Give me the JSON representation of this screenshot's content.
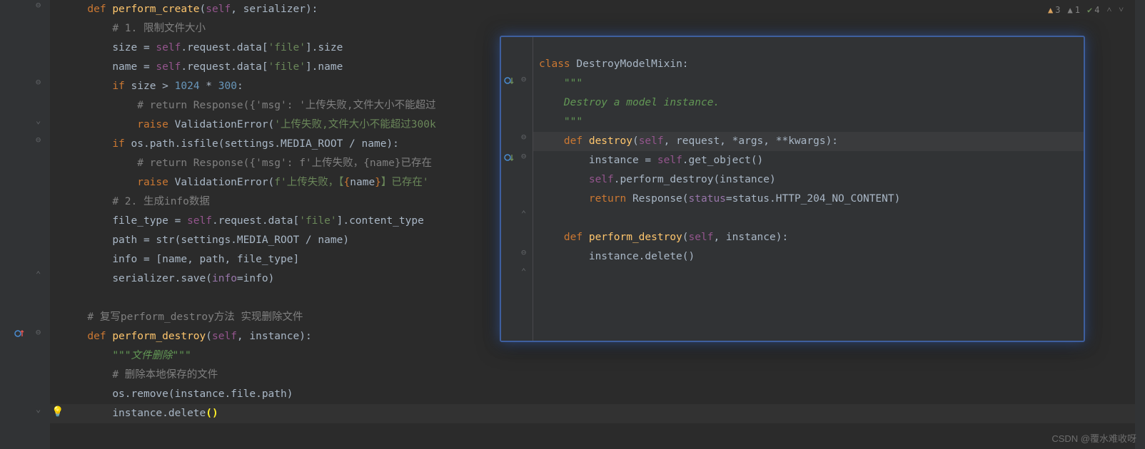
{
  "warnings": {
    "yellow_count": "3",
    "gray_count": "1",
    "green_count": "4"
  },
  "main": {
    "lines": [
      {
        "indent": "    ",
        "tokens": [
          [
            "c-kw",
            "def "
          ],
          [
            "c-funcdef",
            "perform_create"
          ],
          [
            "",
            "("
          ],
          [
            "c-self",
            "self"
          ],
          [
            "",
            ", serializer):"
          ]
        ]
      },
      {
        "indent": "        ",
        "tokens": [
          [
            "c-comment",
            "# 1. 限制文件大小"
          ]
        ]
      },
      {
        "indent": "        ",
        "tokens": [
          [
            "",
            "size = "
          ],
          [
            "c-self",
            "self"
          ],
          [
            "",
            ".request.data["
          ],
          [
            "c-str",
            "'file'"
          ],
          [
            "",
            "].size"
          ]
        ]
      },
      {
        "indent": "        ",
        "tokens": [
          [
            "",
            "name = "
          ],
          [
            "c-self",
            "self"
          ],
          [
            "",
            ".request.data["
          ],
          [
            "c-str",
            "'file'"
          ],
          [
            "",
            "].name"
          ]
        ]
      },
      {
        "indent": "        ",
        "tokens": [
          [
            "c-kw",
            "if "
          ],
          [
            "",
            "size > "
          ],
          [
            "c-num",
            "1024"
          ],
          [
            "",
            " * "
          ],
          [
            "c-num",
            "300"
          ],
          [
            "",
            ":"
          ]
        ]
      },
      {
        "indent": "            ",
        "tokens": [
          [
            "c-comment",
            "# return Response({'msg': '上传失败,文件大小不能超过"
          ]
        ]
      },
      {
        "indent": "            ",
        "tokens": [
          [
            "c-kw",
            "raise "
          ],
          [
            "",
            "ValidationError("
          ],
          [
            "c-str",
            "'上传失败,文件大小不能超过300k"
          ]
        ]
      },
      {
        "indent": "        ",
        "tokens": [
          [
            "c-kw",
            "if "
          ],
          [
            "",
            "os.path.isfile(settings.MEDIA_ROOT / name):"
          ]
        ]
      },
      {
        "indent": "            ",
        "tokens": [
          [
            "c-comment",
            "# return Response({'msg': f'上传失败，{name}已存在"
          ]
        ]
      },
      {
        "indent": "            ",
        "tokens": [
          [
            "c-kw",
            "raise "
          ],
          [
            "",
            "ValidationError("
          ],
          [
            "c-str",
            "f'上传失败，【"
          ],
          [
            "c-kw",
            "{"
          ],
          [
            "",
            "name"
          ],
          [
            "c-kw",
            "}"
          ],
          [
            "c-str",
            "】已存在'"
          ]
        ]
      },
      {
        "indent": "        ",
        "tokens": [
          [
            "c-comment",
            "# 2. 生成info数据"
          ]
        ]
      },
      {
        "indent": "        ",
        "tokens": [
          [
            "",
            "file_type = "
          ],
          [
            "c-self",
            "self"
          ],
          [
            "",
            ".request.data["
          ],
          [
            "c-str",
            "'file'"
          ],
          [
            "",
            "].content_type"
          ]
        ]
      },
      {
        "indent": "        ",
        "tokens": [
          [
            "",
            "path = str(settings.MEDIA_ROOT / name)"
          ]
        ]
      },
      {
        "indent": "        ",
        "tokens": [
          [
            "",
            "info = [name, path, file_type]"
          ]
        ]
      },
      {
        "indent": "        ",
        "tokens": [
          [
            "",
            "serializer.save("
          ],
          [
            "c-field",
            "info"
          ],
          [
            "",
            "=info)"
          ]
        ]
      },
      {
        "indent": "",
        "tokens": [
          [
            "",
            ""
          ]
        ]
      },
      {
        "indent": "    ",
        "tokens": [
          [
            "c-comment",
            "# 复写perform_destroy方法 实现删除文件"
          ]
        ]
      },
      {
        "indent": "    ",
        "tokens": [
          [
            "c-kw",
            "def "
          ],
          [
            "c-funcdef",
            "perform_destroy"
          ],
          [
            "",
            "("
          ],
          [
            "c-self",
            "self"
          ],
          [
            "",
            ", instance):"
          ]
        ]
      },
      {
        "indent": "        ",
        "tokens": [
          [
            "c-docq",
            "\"\"\""
          ],
          [
            "c-doc",
            "文件删除"
          ],
          [
            "c-docq",
            "\"\"\""
          ]
        ]
      },
      {
        "indent": "        ",
        "tokens": [
          [
            "c-comment",
            "# 删除本地保存的文件"
          ]
        ]
      },
      {
        "indent": "        ",
        "tokens": [
          [
            "",
            "os.remove(instance.file.path)"
          ]
        ]
      },
      {
        "indent": "        ",
        "tokens": [
          [
            "",
            "instance.delete"
          ],
          [
            "brace-hl",
            "()"
          ]
        ]
      }
    ]
  },
  "popup": {
    "lines": [
      {
        "indent": "",
        "tokens": [
          [
            "c-kw",
            "class "
          ],
          [
            "",
            "DestroyModelMixin:"
          ]
        ]
      },
      {
        "indent": "    ",
        "tokens": [
          [
            "c-docq",
            "\"\"\""
          ]
        ]
      },
      {
        "indent": "    ",
        "tokens": [
          [
            "c-doc",
            "Destroy a model instance."
          ]
        ]
      },
      {
        "indent": "    ",
        "tokens": [
          [
            "c-docq",
            "\"\"\""
          ]
        ]
      },
      {
        "indent": "    ",
        "tokens": [
          [
            "c-kw",
            "def "
          ],
          [
            "c-funcdef",
            "destroy"
          ],
          [
            "",
            "("
          ],
          [
            "c-self",
            "self"
          ],
          [
            "",
            ", request, *args, **kwargs):"
          ]
        ]
      },
      {
        "indent": "        ",
        "tokens": [
          [
            "",
            "instance = "
          ],
          [
            "c-self",
            "self"
          ],
          [
            "",
            ".get_object()"
          ]
        ]
      },
      {
        "indent": "        ",
        "tokens": [
          [
            "c-self",
            "self"
          ],
          [
            "",
            ".perform_destroy(instance)"
          ]
        ]
      },
      {
        "indent": "        ",
        "tokens": [
          [
            "c-kw",
            "return "
          ],
          [
            "",
            "Response("
          ],
          [
            "c-field",
            "status"
          ],
          [
            "",
            "=status.HTTP_204_NO_CONTENT)"
          ]
        ]
      },
      {
        "indent": "",
        "tokens": [
          [
            "",
            ""
          ]
        ]
      },
      {
        "indent": "    ",
        "tokens": [
          [
            "c-kw",
            "def "
          ],
          [
            "c-funcdef",
            "perform_destroy"
          ],
          [
            "",
            "("
          ],
          [
            "c-self",
            "self"
          ],
          [
            "",
            ", instance):"
          ]
        ]
      },
      {
        "indent": "        ",
        "tokens": [
          [
            "",
            "instance.delete()"
          ]
        ]
      }
    ]
  },
  "watermark": "CSDN @覆水难收呀",
  "override_arrow_up": "↑",
  "override_arrow_down": "↓"
}
